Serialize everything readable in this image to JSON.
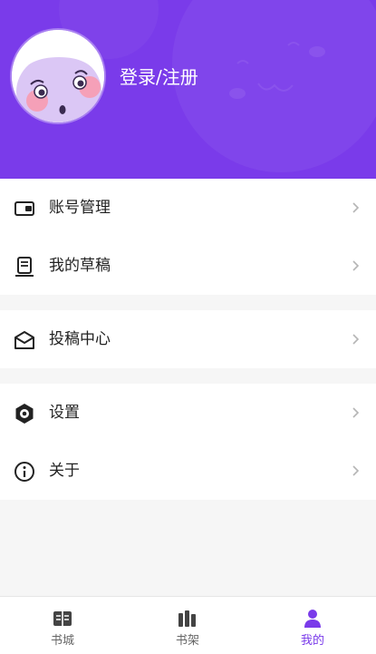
{
  "colors": {
    "brand": "#7a3bea",
    "background": "#f6f6f6",
    "text": "#222222",
    "inactive": "#444444",
    "chevron": "#b5b5b5"
  },
  "header": {
    "login_label": "登录/注册",
    "avatar_icon": "cartoon-face-avatar"
  },
  "menu": {
    "account": {
      "label": "账号管理",
      "icon": "wallet-icon"
    },
    "drafts": {
      "label": "我的草稿",
      "icon": "document-icon"
    },
    "submissions": {
      "label": "投稿中心",
      "icon": "mail-icon"
    },
    "settings": {
      "label": "设置",
      "icon": "settings-icon"
    },
    "about": {
      "label": "关于",
      "icon": "info-icon"
    }
  },
  "tabs": [
    {
      "label": "书城",
      "icon": "open-book-icon",
      "active": false
    },
    {
      "label": "书架",
      "icon": "bookshelf-icon",
      "active": false
    },
    {
      "label": "我的",
      "icon": "person-icon",
      "active": true
    }
  ]
}
